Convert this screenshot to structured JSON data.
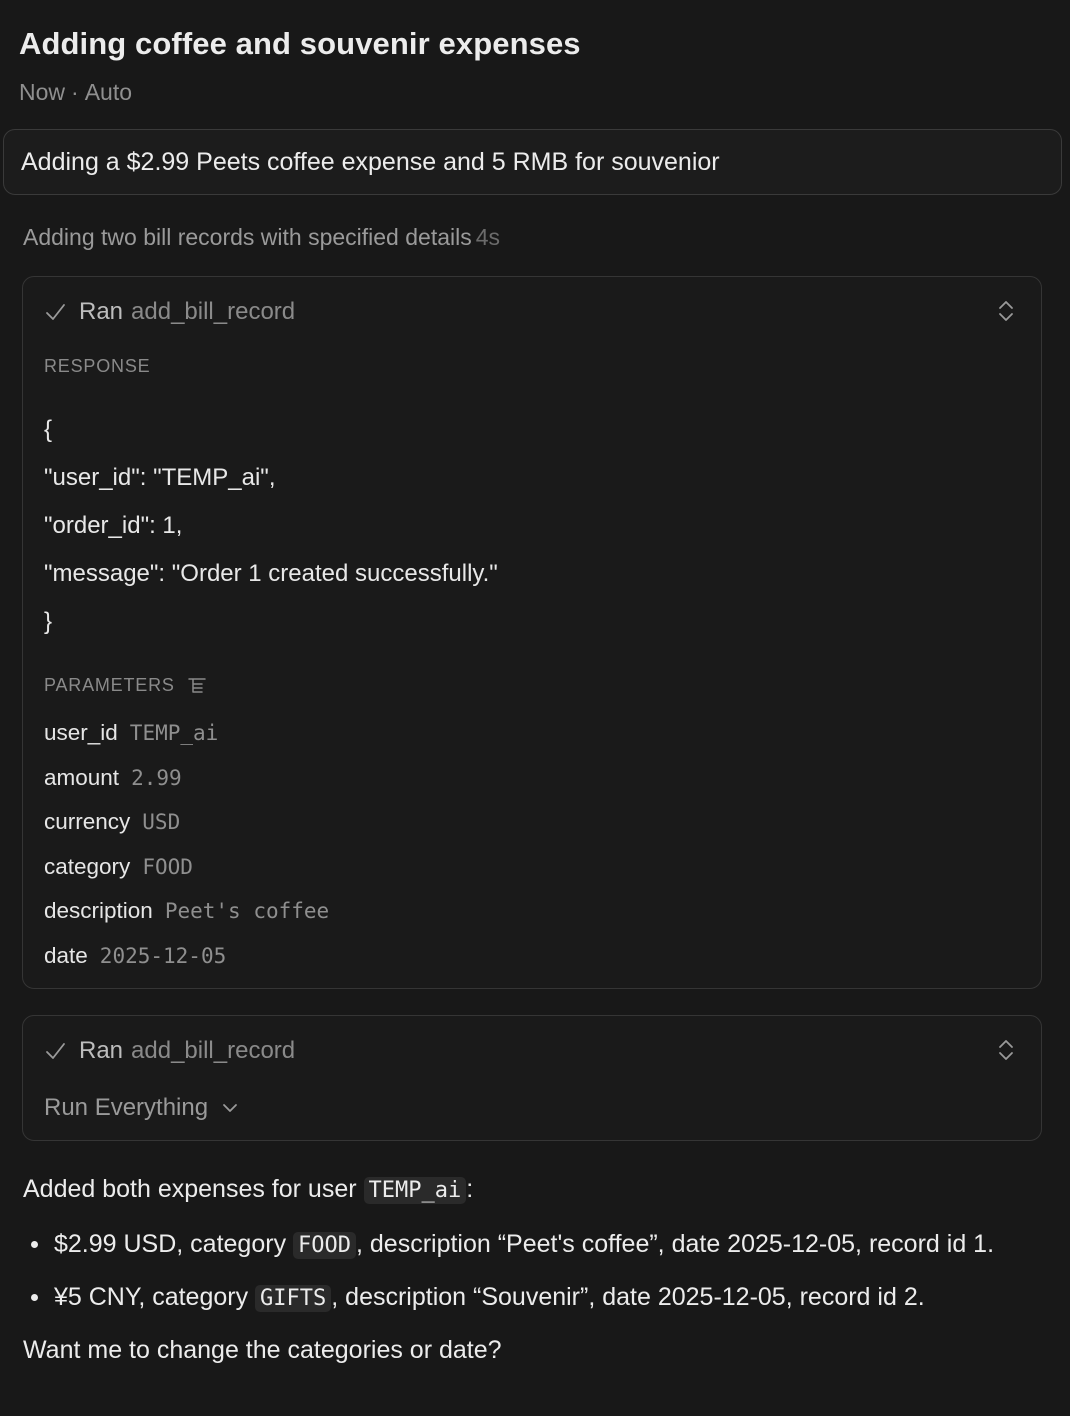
{
  "header": {
    "title": "Adding coffee and souvenir expenses",
    "time": "Now",
    "separator": "·",
    "mode": "Auto"
  },
  "prompt": "Adding a $2.99 Peets coffee expense and 5 RMB for souvenior",
  "thinking": {
    "label": "Adding two bill records with specified details",
    "duration": "4s"
  },
  "tool_call_1": {
    "ran": "Ran",
    "tool": "add_bill_record",
    "response_label": "RESPONSE",
    "response_lines": [
      "{",
      "\"user_id\": \"TEMP_ai\",",
      "\"order_id\": 1,",
      "\"message\": \"Order 1 created successfully.\"",
      "}"
    ],
    "parameters_label": "PARAMETERS",
    "parameters": [
      {
        "key": "user_id",
        "value": "TEMP_ai"
      },
      {
        "key": "amount",
        "value": "2.99"
      },
      {
        "key": "currency",
        "value": "USD"
      },
      {
        "key": "category",
        "value": "FOOD"
      },
      {
        "key": "description",
        "value": "Peet's coffee"
      },
      {
        "key": "date",
        "value": "2025-12-05"
      }
    ]
  },
  "tool_call_2": {
    "ran": "Ran",
    "tool": "add_bill_record",
    "run_mode": "Run Everything"
  },
  "summary": {
    "intro_pre": "Added both expenses for user ",
    "intro_code": "TEMP_ai",
    "intro_post": ":",
    "item1_a": "$2.99 USD, category ",
    "item1_code": "FOOD",
    "item1_b": ", description “Peet's coffee”, date 2025-12-05, record id 1.",
    "item2_a": "¥5 CNY, category ",
    "item2_code": "GIFTS",
    "item2_b": ", description “Souvenir”, date 2025-12-05, record id 2.",
    "closing": "Want me to change the categories or date?"
  }
}
